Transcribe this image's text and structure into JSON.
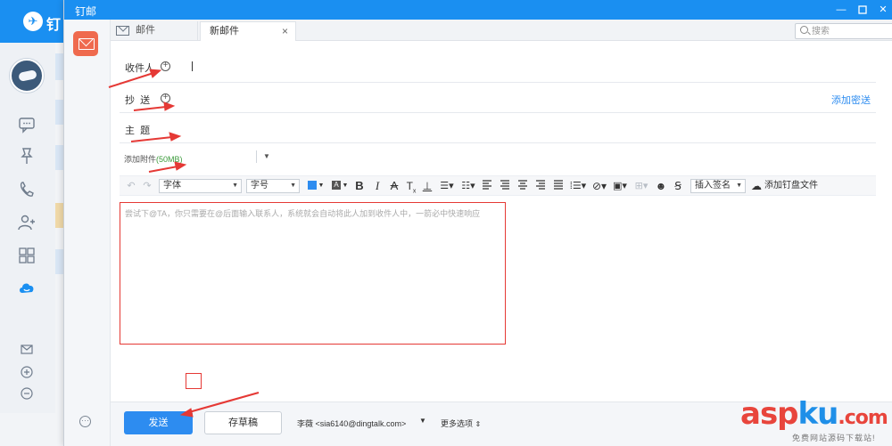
{
  "background_app": {
    "logo_text": "钉",
    "side_icons": [
      "chat-icon",
      "pin-icon",
      "phone-icon",
      "contacts-icon",
      "apps-icon",
      "cloud-icon"
    ],
    "bottom_icons": [
      "mail-icon",
      "plus-circle-icon",
      "more-circle-icon"
    ]
  },
  "window": {
    "title": "钉邮",
    "controls": [
      "minimize",
      "maximize",
      "close"
    ]
  },
  "tabs": [
    {
      "label": "邮件",
      "active": false
    },
    {
      "label": "新邮件",
      "active": true,
      "closable": true
    }
  ],
  "search": {
    "placeholder": "搜索"
  },
  "form": {
    "to_label": "收件人",
    "cc_label": "抄  送",
    "bcc_link": "添加密送",
    "subject_label": "主  题",
    "attach_label": "添加附件",
    "attach_size": "(50MB)"
  },
  "toolbar": {
    "font_select": "字体",
    "size_select": "字号",
    "accent_color": "#2d8cf0",
    "signature_select": "插入签名",
    "cloud_attach": "添加钉盘文件",
    "icons": [
      "undo-icon",
      "redo-icon",
      "font-color-icon",
      "highlight-icon",
      "bold-icon",
      "italic-icon",
      "strikethrough-icon",
      "clear-format-icon",
      "underline-icon",
      "bullet-list-icon",
      "numbered-list-icon",
      "align-left-icon",
      "align-center-icon",
      "align-right-icon",
      "justify-icon",
      "line-height-icon",
      "link-icon",
      "image-icon",
      "table-icon",
      "emoji-icon",
      "signature-icon"
    ]
  },
  "editor": {
    "placeholder": "尝试下@TA，你只需要在@后面输入联系人，系统就会自动将此人加到收件人中，一箭必中快速响应"
  },
  "footer": {
    "send": "发送",
    "save_draft": "存草稿",
    "sender": "李薇 <sia6140@dingtalk.com>",
    "more_options": "更多选项"
  },
  "watermark": {
    "brand_a": "asp",
    "brand_b": "ku",
    "brand_c": ".com",
    "tagline": "免费网站源码下载站!"
  }
}
